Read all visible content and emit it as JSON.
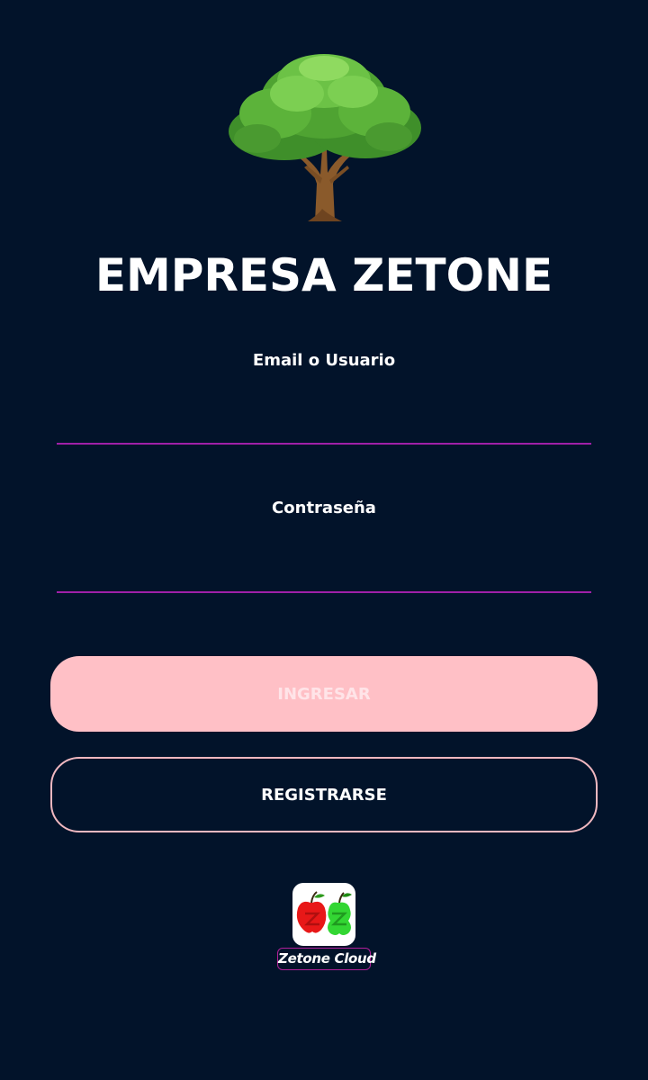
{
  "header": {
    "logo_icon": "tree-icon",
    "title": "EMPRESA ZETONE"
  },
  "form": {
    "email_label": "Email o Usuario",
    "email_value": "",
    "password_label": "Contraseña",
    "password_value": ""
  },
  "actions": {
    "login_label": "INGRESAR",
    "register_label": "REGISTRARSE"
  },
  "footer": {
    "app_icon": "zetone-cloud-logo",
    "app_name": "Zetone Cloud"
  },
  "colors": {
    "background": "#02132a",
    "input_underline": "#a020a8",
    "login_button": "#ffc0c6",
    "register_border": "#f0b8c0",
    "caption_border": "#b0209a"
  }
}
